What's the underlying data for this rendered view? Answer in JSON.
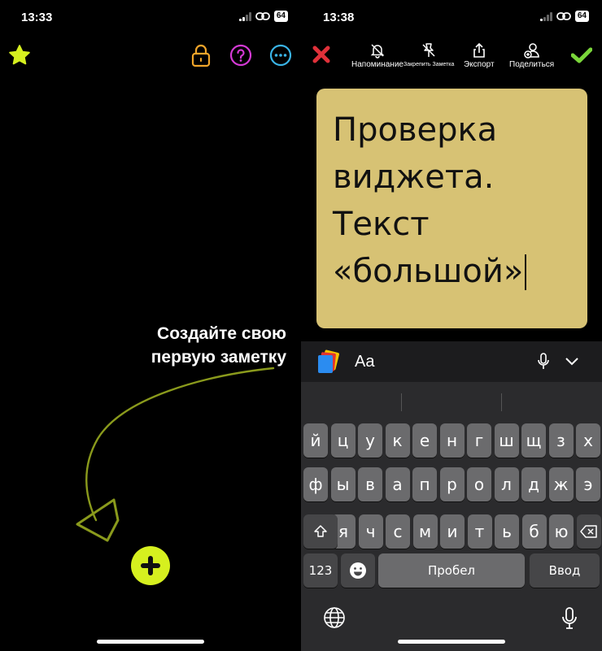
{
  "left": {
    "status": {
      "time": "13:33",
      "battery": "64"
    },
    "colors": {
      "star": "#d6f01f",
      "lock": "#f0a52a",
      "help": "#d63ad6",
      "more": "#3ab4e6",
      "fab": "#d6f01f"
    },
    "hint": {
      "line1": "Создайте свою",
      "line2": "первую заметку"
    }
  },
  "right": {
    "status": {
      "time": "13:38",
      "battery": "64"
    },
    "toolbar": {
      "reminder": "Напоминание",
      "pin": "Закрепить Заметка",
      "export": "Экспорт",
      "share": "Поделиться"
    },
    "colors": {
      "close": "#e0313a",
      "confirm": "#7ad63a",
      "note_bg": "#d7c274"
    },
    "note": {
      "line1": "Проверка",
      "line2": "виджета.",
      "line3": "Текст",
      "line4": "«большой»"
    },
    "accessory": {
      "format": "Aa"
    },
    "keyboard": {
      "row1": [
        "й",
        "ц",
        "у",
        "к",
        "е",
        "н",
        "г",
        "ш",
        "щ",
        "з",
        "х"
      ],
      "row2": [
        "ф",
        "ы",
        "в",
        "а",
        "п",
        "р",
        "о",
        "л",
        "д",
        "ж",
        "э"
      ],
      "row3": [
        "я",
        "ч",
        "с",
        "м",
        "и",
        "т",
        "ь",
        "б",
        "ю"
      ],
      "numbers": "123",
      "space": "Пробел",
      "enter": "Ввод"
    }
  }
}
